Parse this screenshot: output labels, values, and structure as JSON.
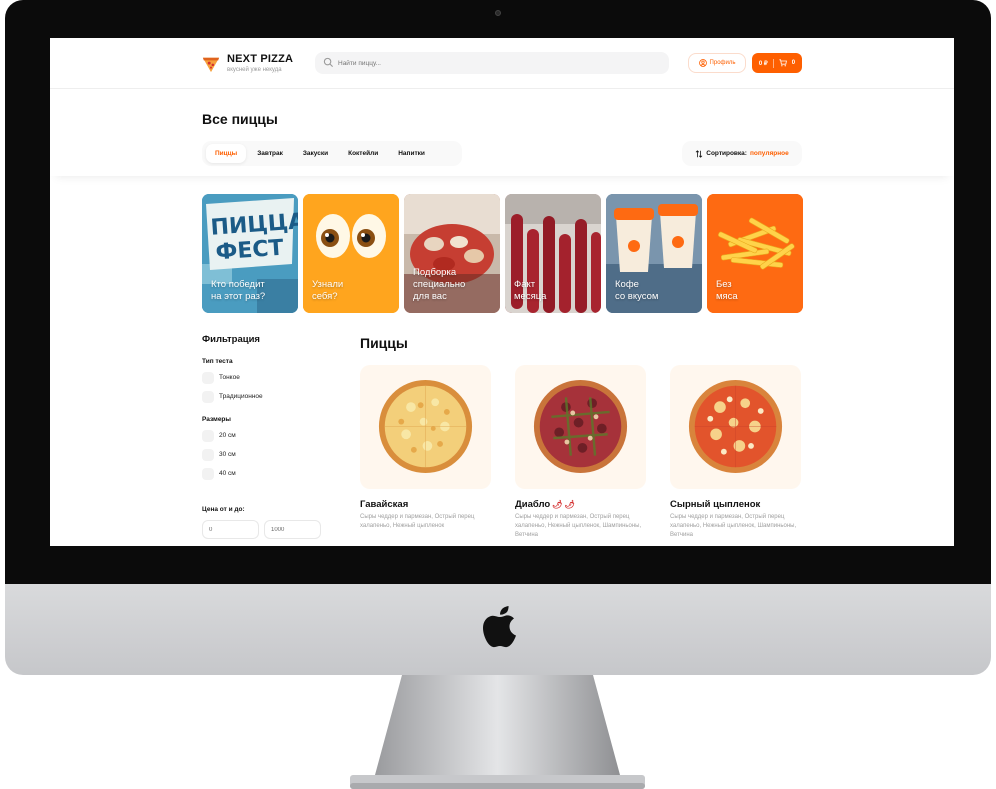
{
  "header": {
    "logo_title": "NEXT PIZZA",
    "logo_subtitle": "вкусней уже некуда",
    "search_placeholder": "Найти пиццу...",
    "profile_label": "Профиль",
    "cart_total": "0 ₽",
    "cart_count": "0"
  },
  "page": {
    "title": "Все пиццы",
    "categories": [
      "Пиццы",
      "Завтрак",
      "Закуски",
      "Коктейли",
      "Напитки"
    ],
    "active_category": "Пиццы",
    "sort_label": "Сортировка:",
    "sort_value": "популярное"
  },
  "stories": [
    {
      "caption": "Кто победит\nна этот раз?",
      "badge": "ПИЦЦА ФЕСТ",
      "color": "#4a9cc0"
    },
    {
      "caption": "Узнали\nсебя?",
      "color": "#ffa31a"
    },
    {
      "caption": "Подборка\nспециально\nдля вас",
      "color": "#b8544a"
    },
    {
      "caption": "Факт\nмесяца",
      "color": "#8e1e28"
    },
    {
      "caption": "Кофе\nсо вкусом",
      "color": "#4b6f8f"
    },
    {
      "caption": "Без\nмяса",
      "color": "#fe6a12"
    }
  ],
  "filters": {
    "title": "Фильтрация",
    "dough_title": "Тип теста",
    "dough_options": [
      "Тонкое",
      "Традиционное"
    ],
    "sizes_title": "Размеры",
    "size_options": [
      "20 см",
      "30 см",
      "40 см"
    ],
    "price_title": "Цена от и до:",
    "price_from": "0",
    "price_to": "1000"
  },
  "catalog": {
    "section_title": "Пиццы",
    "products": [
      {
        "name": "Гавайская",
        "spicy": false,
        "description": "Сыры чеддер и пармезан, Острый перец халапеньо, Нежный цыпленок",
        "topping_color": "#e8b04a"
      },
      {
        "name": "Диабло",
        "spicy": true,
        "pepper_icons": "🌶 🌶",
        "description": "Сыры чеддер и пармезан, Острый перец халапеньо, Нежный цыпленок, Шампиньоны, Ветчина",
        "topping_color": "#a6323a"
      },
      {
        "name": "Сырный цыпленок",
        "spicy": false,
        "description": "Сыры чеддер и пармезан, Острый перец халапеньо, Нежный цыпленок, Шампиньоны, Ветчина",
        "topping_color": "#e2542c"
      }
    ]
  },
  "colors": {
    "accent": "#fe5f00",
    "bezel": "#0b0b0b",
    "chin": "#d2d3d6"
  }
}
